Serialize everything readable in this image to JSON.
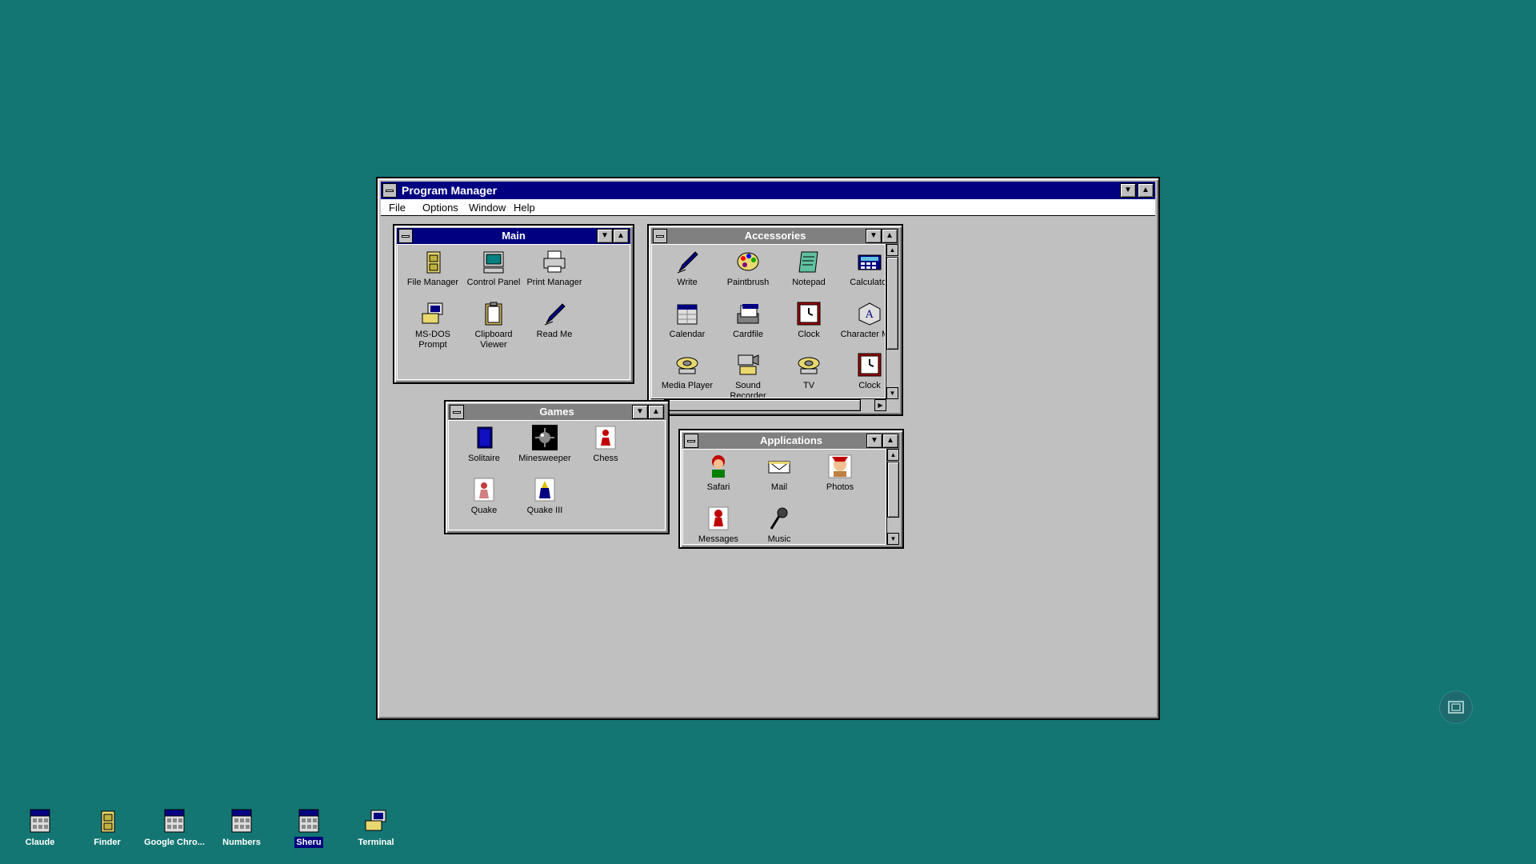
{
  "program_manager": {
    "title": "Program Manager",
    "menu": [
      "File",
      "Options",
      "Window",
      "Help"
    ]
  },
  "groups": {
    "main": {
      "title": "Main",
      "items": [
        "File Manager",
        "Control Panel",
        "Print Manager",
        "MS-DOS Prompt",
        "Clipboard Viewer",
        "Read Me"
      ]
    },
    "accessories": {
      "title": "Accessories",
      "items": [
        "Write",
        "Paintbrush",
        "Notepad",
        "Calculator",
        "Calendar",
        "Cardfile",
        "Clock",
        "Character Map",
        "Media Player",
        "Sound Recorder",
        "TV",
        "Clock"
      ]
    },
    "games": {
      "title": "Games",
      "items": [
        "Solitaire",
        "Minesweeper",
        "Chess",
        "Quake",
        "Quake III"
      ]
    },
    "applications": {
      "title": "Applications",
      "items": [
        "Safari",
        "Mail",
        "Photos",
        "Messages",
        "Music"
      ]
    }
  },
  "desktop_icons": [
    "Claude",
    "Finder",
    "Google Chro...",
    "Numbers",
    "Sheru",
    "Terminal"
  ],
  "icons": {
    "main": [
      "file-cabinet-icon",
      "control-panel-icon",
      "printer-icon",
      "ms-dos-icon",
      "clipboard-icon",
      "pen-icon"
    ],
    "accessories": [
      "pen-icon",
      "palette-icon",
      "notepad-icon",
      "calculator-icon",
      "calendar-icon",
      "cardfile-icon",
      "clock-icon",
      "character-map-icon",
      "media-player-icon",
      "sound-recorder-icon",
      "tv-icon",
      "clock-icon"
    ],
    "games": [
      "solitaire-icon",
      "minesweeper-icon",
      "chess-icon",
      "quake-icon",
      "quake3-icon"
    ],
    "applications": [
      "safari-icon",
      "mail-icon",
      "photos-icon",
      "messages-icon",
      "music-icon"
    ]
  }
}
